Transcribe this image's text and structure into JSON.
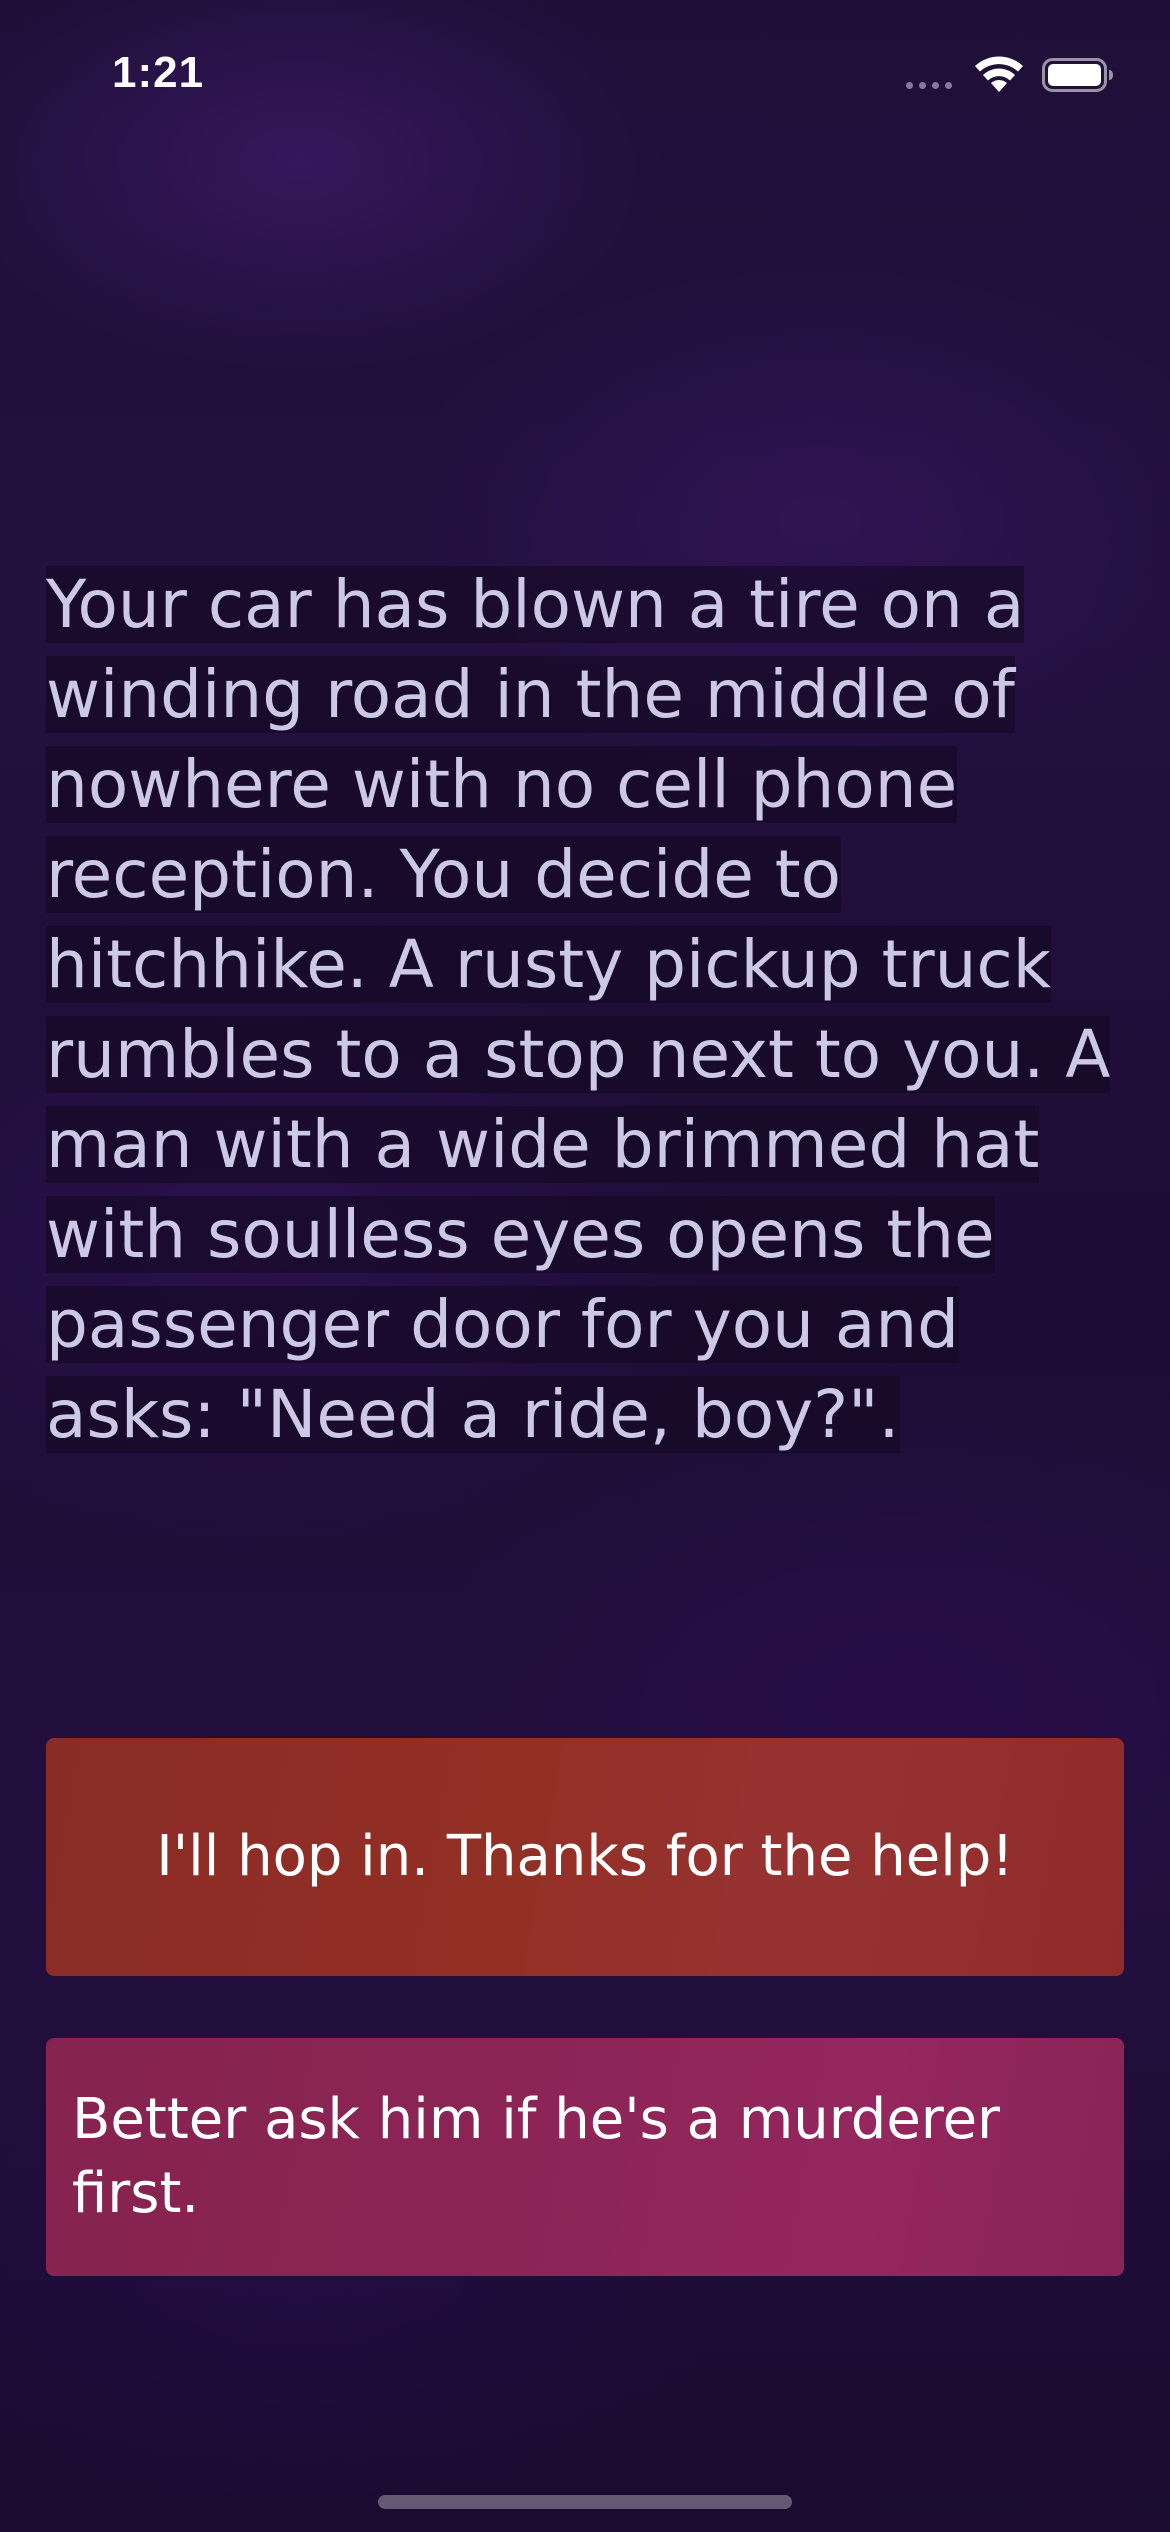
{
  "status_bar": {
    "time": "1:21",
    "icons": [
      "signal-dots-icon",
      "wifi-icon",
      "battery-icon"
    ]
  },
  "story": {
    "text": "Your car has blown a tire on a winding road in the middle of nowhere with no cell phone reception. You decide to hitchhike. A rusty pickup truck rumbles to a stop next to you. A man with a wide brimmed hat with soulless eyes opens the passenger door for you and asks: \"Need a ride, boy?\"."
  },
  "choices": {
    "first_label": "I'll hop in. Thanks for the help!",
    "second_label": "Better ask him if he's a murderer first."
  },
  "colors": {
    "background": "#1f0f38",
    "story_text": "#cbc9e6",
    "choice_one": "#933026",
    "choice_two": "#8b2455"
  }
}
